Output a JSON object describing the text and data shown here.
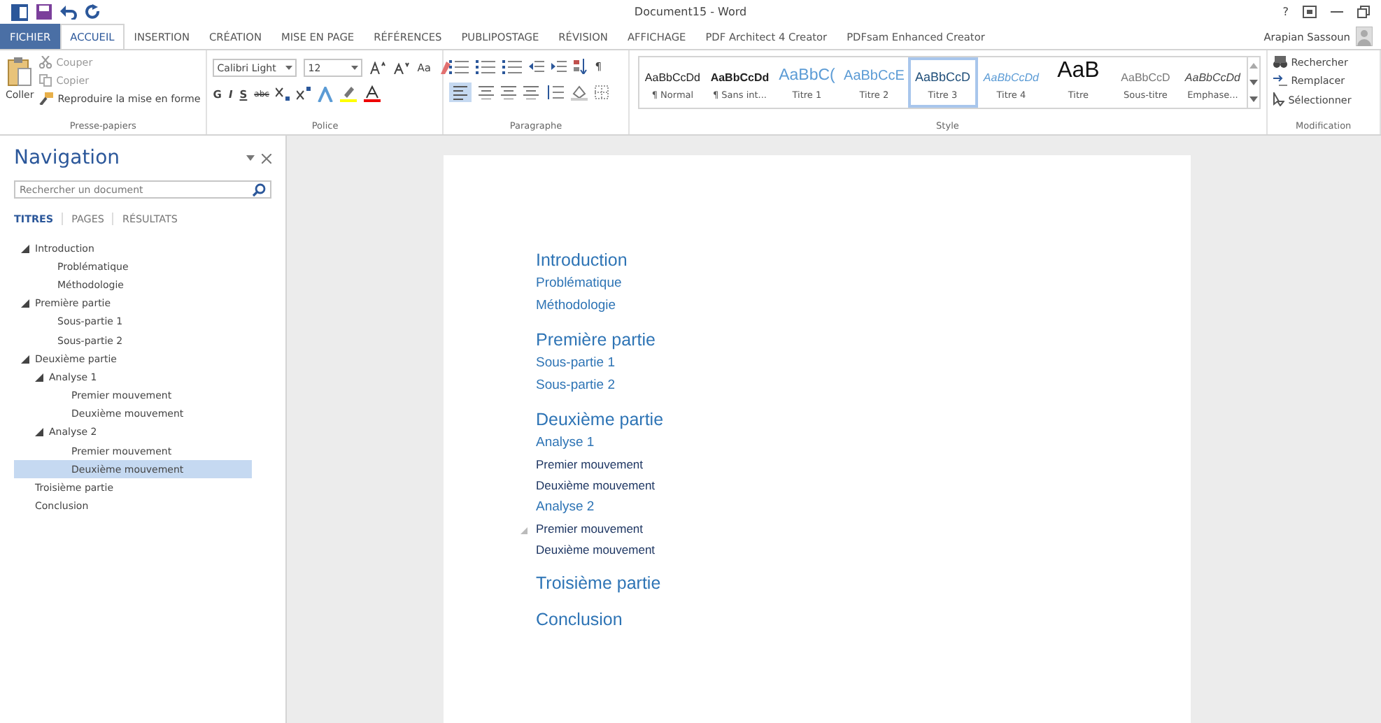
{
  "window": {
    "title": "Document15 - Word",
    "help": "?",
    "user": "Arapian Sassoun"
  },
  "tabs": [
    {
      "label": "FICHIER",
      "kind": "file",
      "selected": false
    },
    {
      "label": "ACCUEIL",
      "kind": "tab",
      "selected": true
    },
    {
      "label": "INSERTION",
      "kind": "tab",
      "selected": false
    },
    {
      "label": "CRÉATION",
      "kind": "tab",
      "selected": false
    },
    {
      "label": "MISE EN PAGE",
      "kind": "tab",
      "selected": false
    },
    {
      "label": "RÉFÉRENCES",
      "kind": "tab",
      "selected": false
    },
    {
      "label": "PUBLIPOSTAGE",
      "kind": "tab",
      "selected": false
    },
    {
      "label": "RÉVISION",
      "kind": "tab",
      "selected": false
    },
    {
      "label": "AFFICHAGE",
      "kind": "tab",
      "selected": false
    },
    {
      "label": "PDF Architect 4 Creator",
      "kind": "tab",
      "selected": false
    },
    {
      "label": "PDFsam Enhanced Creator",
      "kind": "tab",
      "selected": false
    }
  ],
  "clipboard": {
    "paste": "Coller",
    "cut": "Couper",
    "copy": "Copier",
    "format_painter": "Reproduire la mise en forme",
    "label": "Presse-papiers"
  },
  "font": {
    "name": "Calibri Light",
    "size": "12",
    "case": "Aa",
    "bold": "G",
    "italic": "I",
    "underline": "S",
    "strike": "abc",
    "label": "Police"
  },
  "paragraph": {
    "pilcrow": "¶",
    "label": "Paragraphe"
  },
  "styles": {
    "label": "Style",
    "items": [
      {
        "preview": "AaBbCcDd",
        "name": "¶ Normal",
        "kind": "normal",
        "selected": false
      },
      {
        "preview": "AaBbCcDd",
        "name": "¶ Sans int...",
        "kind": "strong",
        "selected": false
      },
      {
        "preview": "AaBbC(",
        "name": "Titre 1",
        "kind": "h1",
        "selected": false
      },
      {
        "preview": "AaBbCcE",
        "name": "Titre 2",
        "kind": "h2",
        "selected": false
      },
      {
        "preview": "AaBbCcD",
        "name": "Titre 3",
        "kind": "h3",
        "selected": true
      },
      {
        "preview": "AaBbCcDd",
        "name": "Titre 4",
        "kind": "h4",
        "selected": false
      },
      {
        "preview": "AaB",
        "name": "Titre",
        "kind": "title",
        "selected": false
      },
      {
        "preview": "AaBbCcD",
        "name": "Sous-titre",
        "kind": "subtitle",
        "selected": false
      },
      {
        "preview": "AaBbCcDd",
        "name": "Emphase...",
        "kind": "emphasis",
        "selected": false
      }
    ]
  },
  "editing": {
    "find": "Rechercher",
    "replace": "Remplacer",
    "select": "Sélectionner",
    "label": "Modification"
  },
  "navigation": {
    "title": "Navigation",
    "search": {
      "placeholder": "Rechercher un document"
    },
    "tabs": [
      {
        "label": "TITRES",
        "selected": true
      },
      {
        "label": "PAGES",
        "selected": false
      },
      {
        "label": "RÉSULTATS",
        "selected": false
      }
    ],
    "tree": [
      {
        "label": "Introduction",
        "expanded": true,
        "selected": false,
        "children": [
          {
            "label": "Problématique",
            "selected": false
          },
          {
            "label": "Méthodologie",
            "selected": false
          }
        ]
      },
      {
        "label": "Première partie",
        "expanded": true,
        "selected": false,
        "children": [
          {
            "label": "Sous-partie 1",
            "selected": false
          },
          {
            "label": "Sous-partie 2",
            "selected": false
          }
        ]
      },
      {
        "label": "Deuxième partie",
        "expanded": true,
        "selected": false,
        "children": [
          {
            "label": "Analyse 1",
            "expanded": true,
            "selected": false,
            "children": [
              {
                "label": "Premier mouvement",
                "selected": false
              },
              {
                "label": "Deuxième mouvement",
                "selected": false
              }
            ]
          },
          {
            "label": "Analyse 2",
            "expanded": true,
            "selected": false,
            "children": [
              {
                "label": "Premier mouvement",
                "selected": false
              },
              {
                "label": "Deuxième mouvement",
                "selected": true
              }
            ]
          }
        ]
      },
      {
        "label": "Troisième partie",
        "selected": false
      },
      {
        "label": "Conclusion",
        "selected": false
      }
    ]
  },
  "document": {
    "paragraphs": [
      {
        "text": "Introduction",
        "kind": "heading1"
      },
      {
        "text": "Problématique",
        "kind": "heading2"
      },
      {
        "text": "Méthodologie",
        "kind": "heading2"
      },
      {
        "text": "Première partie",
        "kind": "heading1"
      },
      {
        "text": "Sous-partie 1",
        "kind": "heading2"
      },
      {
        "text": "Sous-partie 2",
        "kind": "heading2"
      },
      {
        "text": "Deuxième partie",
        "kind": "heading1"
      },
      {
        "text": "Analyse 1",
        "kind": "heading2"
      },
      {
        "text": "Premier mouvement",
        "kind": "heading3"
      },
      {
        "text": "Deuxième mouvement",
        "kind": "heading3"
      },
      {
        "text": "Analyse 2",
        "kind": "heading2"
      },
      {
        "text": "Premier mouvement",
        "kind": "heading3",
        "hovered": true
      },
      {
        "text": "Deuxième mouvement",
        "kind": "heading3"
      },
      {
        "text": "Troisième partie",
        "kind": "heading1"
      },
      {
        "text": "Conclusion",
        "kind": "heading1"
      }
    ]
  }
}
